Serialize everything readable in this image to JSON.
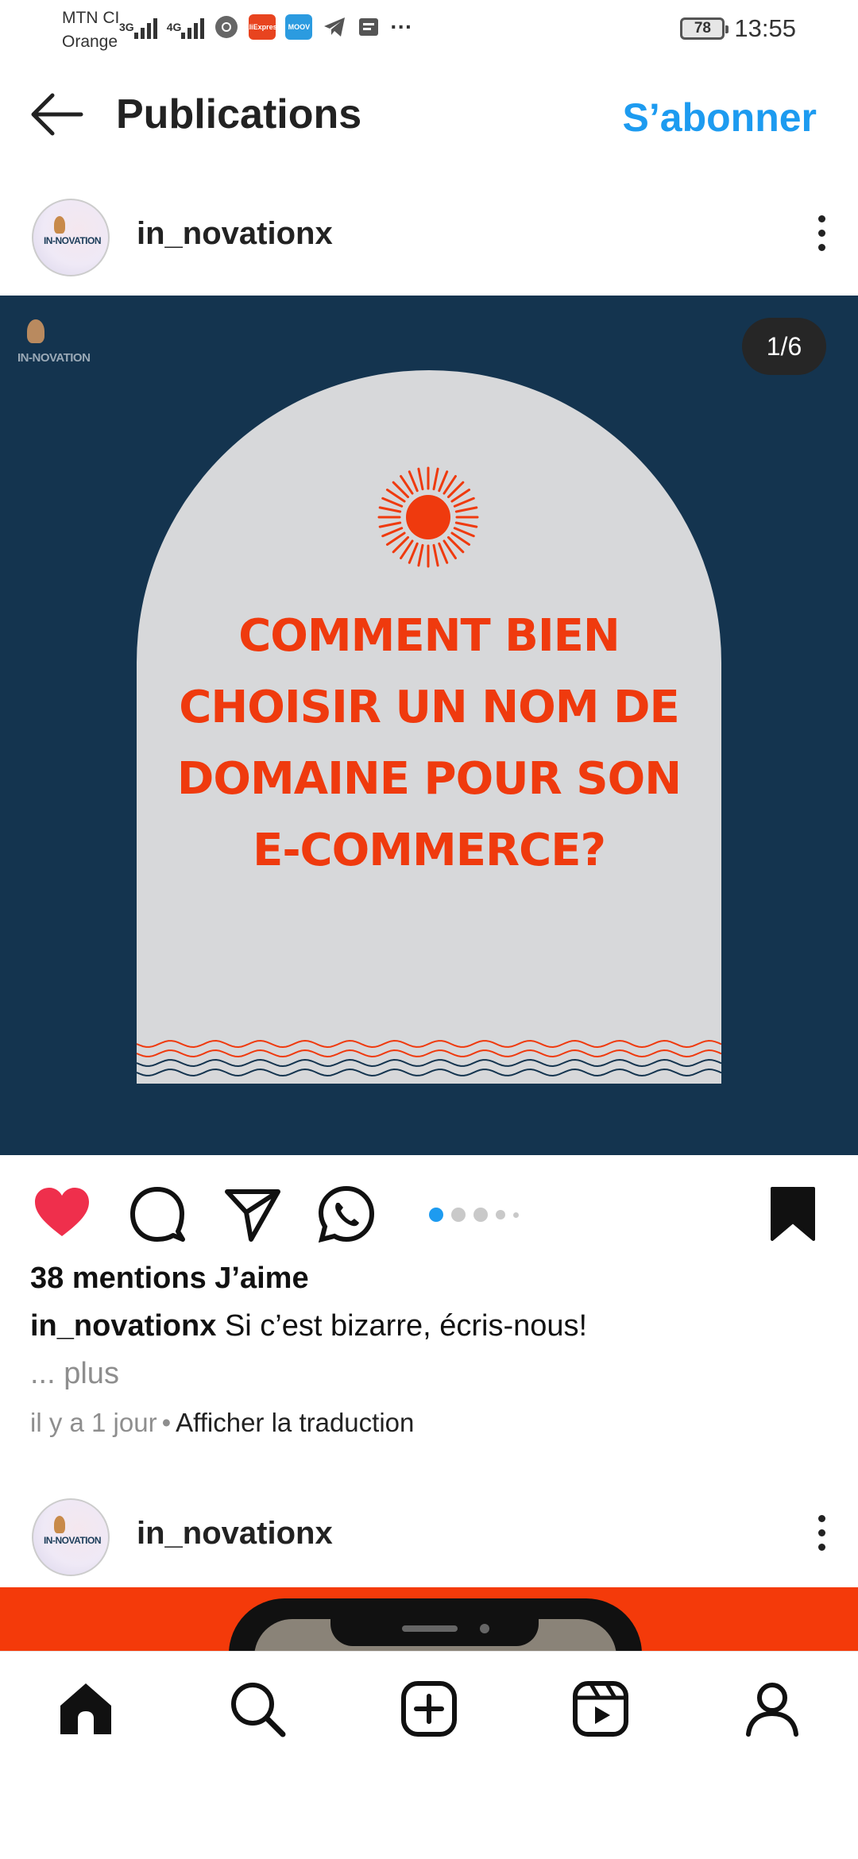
{
  "status_bar": {
    "carrier_1": "MTN CI",
    "carrier_2": "Orange",
    "net_1": "3G",
    "net_2": "4G",
    "app_icons": [
      "chrome-icon",
      "aliexpress-icon",
      "moov-icon",
      "telegram-icon",
      "message-icon"
    ],
    "app_label_1": "AliExpress",
    "app_label_2": "MOOV",
    "overflow": "···",
    "battery": "78",
    "time": "13:55"
  },
  "header": {
    "title": "Publications",
    "follow_label": "S’abonner"
  },
  "post": {
    "username": "in_novationx",
    "avatar_text": "IN-NOVATION",
    "brand_text": "IN-NOVATION",
    "counter": "1/6",
    "headline": [
      "COMMENT BIEN",
      "CHOISIR UN NOM DE",
      "DOMAINE POUR SON",
      "E-COMMERCE?"
    ],
    "likes": "38 mentions J’aime",
    "caption_user": "in_novationx",
    "caption_text": "Si c’est bizarre, écris-nous!",
    "more": "... plus",
    "time_ago": "il y a 1 jour",
    "separator": "•",
    "translate": "Afficher la traduction",
    "carousel_active_index": 0,
    "carousel_dots_visible": 5
  },
  "next_post": {
    "username": "in_novationx",
    "avatar_text": "IN-NOVATION"
  },
  "colors": {
    "accent": "#1d9bf0",
    "like": "#ef2f4c",
    "media_bg": "#14344f",
    "headline": "#ef3a0e",
    "dot_active": "#1d9bf0",
    "preview_bg": "#f43a0a"
  },
  "bottom_nav": [
    "home-icon",
    "search-icon",
    "create-icon",
    "reels-icon",
    "profile-icon"
  ]
}
